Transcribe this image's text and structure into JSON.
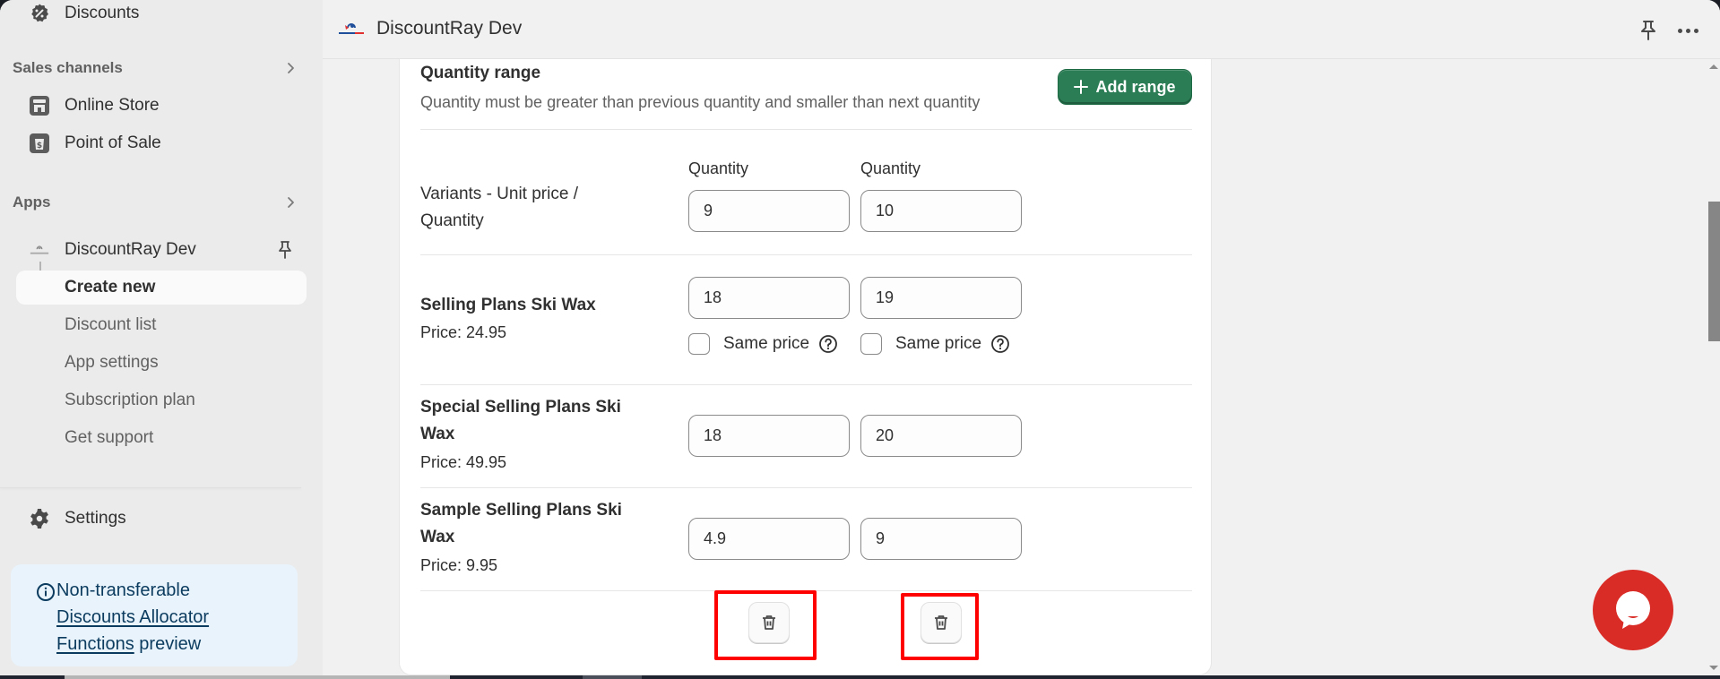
{
  "sidebar": {
    "discounts_label": "Discounts",
    "sales_channels": {
      "header": "Sales channels",
      "items": [
        {
          "label": "Online Store",
          "icon": "store-icon"
        },
        {
          "label": "Point of Sale",
          "icon": "pos-icon"
        }
      ]
    },
    "apps": {
      "header": "Apps",
      "app_name": "DiscountRay Dev",
      "sub_items": [
        {
          "label": "Create new",
          "active": true
        },
        {
          "label": "Discount list"
        },
        {
          "label": "App settings"
        },
        {
          "label": "Subscription plan"
        },
        {
          "label": "Get support"
        }
      ]
    },
    "settings_label": "Settings",
    "notice": {
      "prefix": "Non-transferable",
      "link": "Discounts Allocator Functions",
      "link_line1": "Discounts Allocator",
      "link_line2": "Functions",
      "suffix": "preview"
    }
  },
  "topbar": {
    "app_title": "DiscountRay Dev",
    "logo_text": "DiscountRay"
  },
  "card": {
    "title": "Quantity range",
    "description": "Quantity must be greater than previous quantity and smaller than next quantity",
    "add_button": "Add range",
    "column_headers": [
      "Quantity",
      "Quantity"
    ],
    "rows": [
      {
        "label": "Variants - Unit price / Quantity",
        "bold": false,
        "price": null,
        "values": [
          "9",
          "10"
        ]
      },
      {
        "label": "Selling Plans Ski Wax",
        "bold": true,
        "price": "Price: 24.95",
        "values": [
          "18",
          "19"
        ],
        "same_price": [
          {
            "label": "Same price",
            "checked": false
          },
          {
            "label": "Same price",
            "checked": false
          }
        ]
      },
      {
        "label": "Special Selling Plans Ski Wax",
        "bold": true,
        "price": "Price: 49.95",
        "values": [
          "18",
          "20"
        ]
      },
      {
        "label": "Sample Selling Plans Ski Wax",
        "bold": true,
        "price": "Price: 9.95",
        "values": [
          "4.9",
          "9"
        ]
      }
    ],
    "delete_buttons": [
      "delete-range-1",
      "delete-range-2"
    ]
  },
  "colors": {
    "primary_button": "#2a7d55",
    "chat_bubble": "#d92c27",
    "annotation_box": "#ff0000",
    "notice_bg": "#e8f3fc",
    "notice_text": "#0b3b5e"
  }
}
